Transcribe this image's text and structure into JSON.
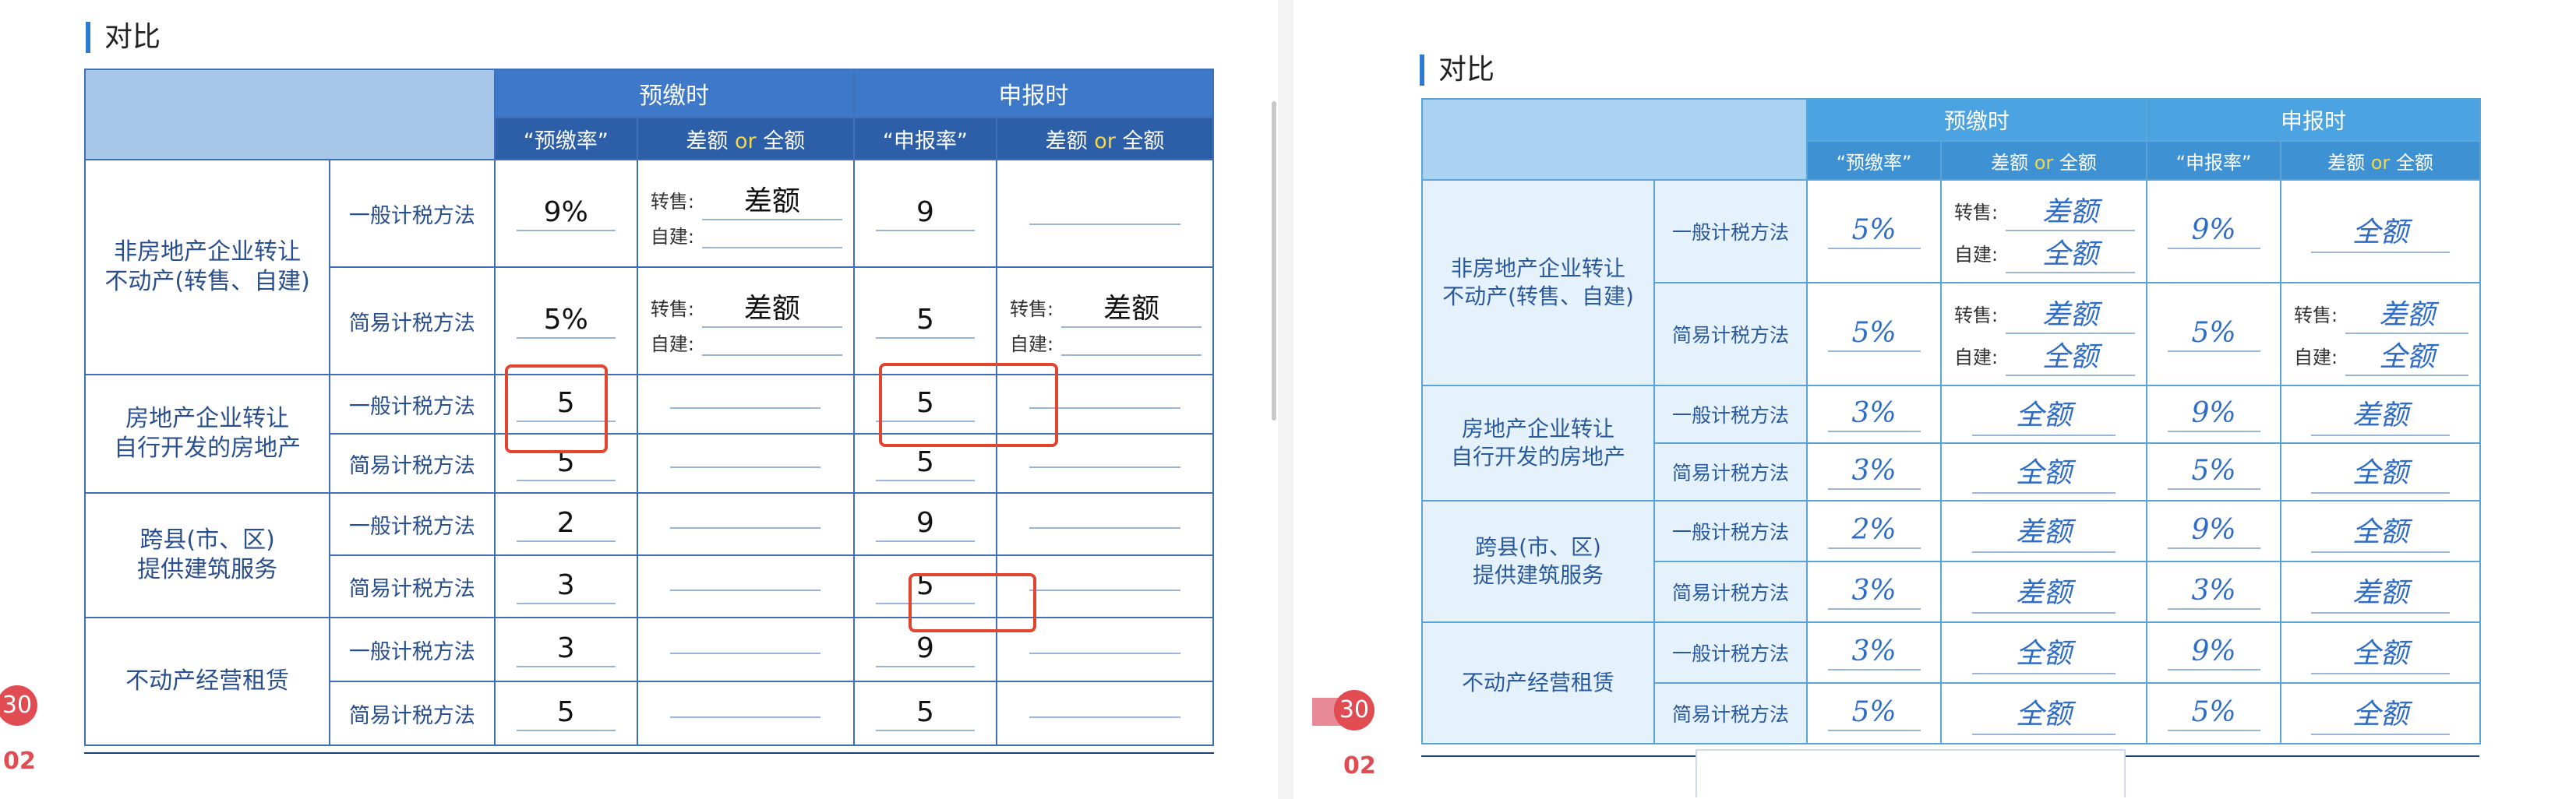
{
  "left": {
    "title": "对比",
    "groups": [
      "预缴时",
      "申报时"
    ],
    "subheaders": [
      "“预缴率”",
      "差额",
      "or",
      "全额",
      "“申报率”",
      "差额",
      "or",
      "全额"
    ],
    "rows": [
      {
        "label": "非房地产企业转让\n不动产(转售、自建)",
        "methods": [
          {
            "name": "一般计税方法",
            "pre_rate": "9%",
            "pre_sale_label": "转售:",
            "pre_sale": "差额",
            "pre_self_label": "自建:",
            "pre_self": "",
            "dec_rate": "9",
            "dec_sale_label": "",
            "dec_sale": "",
            "dec_self_label": "",
            "dec_self": ""
          },
          {
            "name": "简易计税方法",
            "pre_rate": "5%",
            "pre_sale_label": "转售:",
            "pre_sale": "差额",
            "pre_self_label": "自建:",
            "pre_self": "",
            "dec_rate": "5",
            "dec_sale_label": "转售:",
            "dec_sale": "差额",
            "dec_self_label": "自建:",
            "dec_self": ""
          }
        ]
      },
      {
        "label": "房地产企业转让\n自行开发的房地产",
        "methods": [
          {
            "name": "一般计税方法",
            "pre_rate": "5",
            "pre_amt": "",
            "dec_rate": "5",
            "dec_amt": ""
          },
          {
            "name": "简易计税方法",
            "pre_rate": "5",
            "pre_amt": "",
            "dec_rate": "5",
            "dec_amt": ""
          }
        ]
      },
      {
        "label": "跨县(市、区)\n提供建筑服务",
        "methods": [
          {
            "name": "一般计税方法",
            "pre_rate": "2",
            "pre_amt": "",
            "dec_rate": "9",
            "dec_amt": ""
          },
          {
            "name": "简易计税方法",
            "pre_rate": "3",
            "pre_amt": "",
            "dec_rate": "5",
            "dec_amt": ""
          }
        ]
      },
      {
        "label": "不动产经营租赁",
        "methods": [
          {
            "name": "一般计税方法",
            "pre_rate": "3",
            "pre_amt": "",
            "dec_rate": "9",
            "dec_amt": ""
          },
          {
            "name": "简易计税方法",
            "pre_rate": "5",
            "pre_amt": "",
            "dec_rate": "5",
            "dec_amt": ""
          }
        ]
      }
    ],
    "page_number": "30",
    "page_sub": "02"
  },
  "right": {
    "title": "对比",
    "groups": [
      "预缴时",
      "申报时"
    ],
    "subheaders": [
      "“预缴率”",
      "差额",
      "or",
      "全额",
      "“申报率”",
      "差额",
      "or",
      "全额"
    ],
    "rows": [
      {
        "label": "非房地产企业转让\n不动产(转售、自建)",
        "methods": [
          {
            "name": "一般计税方法",
            "pre_rate": "5%",
            "pre_sale_label": "转售:",
            "pre_sale": "差额",
            "pre_self_label": "自建:",
            "pre_self": "全额",
            "dec_rate": "9%",
            "dec_amt": "全额"
          },
          {
            "name": "简易计税方法",
            "pre_rate": "5%",
            "pre_sale_label": "转售:",
            "pre_sale": "差额",
            "pre_self_label": "自建:",
            "pre_self": "全额",
            "dec_rate": "5%",
            "dec_sale_label": "转售:",
            "dec_sale": "差额",
            "dec_self_label": "自建:",
            "dec_self": "全额"
          }
        ]
      },
      {
        "label": "房地产企业转让\n自行开发的房地产",
        "methods": [
          {
            "name": "一般计税方法",
            "pre_rate": "3%",
            "pre_amt": "全额",
            "dec_rate": "9%",
            "dec_amt": "差额"
          },
          {
            "name": "简易计税方法",
            "pre_rate": "3%",
            "pre_amt": "全额",
            "dec_rate": "5%",
            "dec_amt": "全额"
          }
        ]
      },
      {
        "label": "跨县(市、区)\n提供建筑服务",
        "methods": [
          {
            "name": "一般计税方法",
            "pre_rate": "2%",
            "pre_amt": "差额",
            "dec_rate": "9%",
            "dec_amt": "全额"
          },
          {
            "name": "简易计税方法",
            "pre_rate": "3%",
            "pre_amt": "差额",
            "dec_rate": "3%",
            "dec_amt": "差额"
          }
        ]
      },
      {
        "label": "不动产经营租赁",
        "methods": [
          {
            "name": "一般计税方法",
            "pre_rate": "3%",
            "pre_amt": "全额",
            "dec_rate": "9%",
            "dec_amt": "全额"
          },
          {
            "name": "简易计税方法",
            "pre_rate": "5%",
            "pre_amt": "全额",
            "dec_rate": "5%",
            "dec_amt": "全额"
          }
        ]
      }
    ],
    "page_number": "30",
    "page_sub": "02"
  },
  "colors": {
    "left_header": "#3d78c9",
    "right_header": "#4ba3e2",
    "highlight": "#e0462f",
    "badge": "#e14b52"
  }
}
